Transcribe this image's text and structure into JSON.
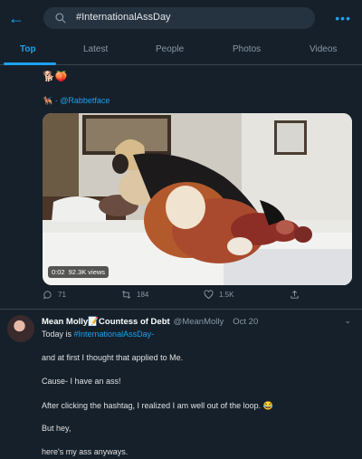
{
  "search": {
    "query": "#InternationalAssDay"
  },
  "tabs": [
    "Top",
    "Latest",
    "People",
    "Photos",
    "Videos"
  ],
  "retweet_context": {
    "emoji_line": "🐕🍑",
    "prefix": "🐕‍🦺 · ",
    "handle": "@Rabbetface"
  },
  "video": {
    "time": "0:02",
    "views": "92.3K views"
  },
  "actions": {
    "replies": "71",
    "retweets": "184",
    "likes": "1.5K"
  },
  "tweet": {
    "name": "Mean Molly📝Countess of Debt",
    "handle": "@MeanMolly",
    "date": "Oct 20",
    "line1_prefix": "Today is ",
    "line1_tag": "#InternationalAssDay",
    "line1_suffix": "-",
    "line2": "and at first I thought that applied to Me.",
    "line3": "Cause- I have an ass!",
    "line4": "After clicking the hashtag, I realized I am well out of the loop. 😂",
    "line5": "But hey,",
    "line6": "here's my ass anyways."
  }
}
